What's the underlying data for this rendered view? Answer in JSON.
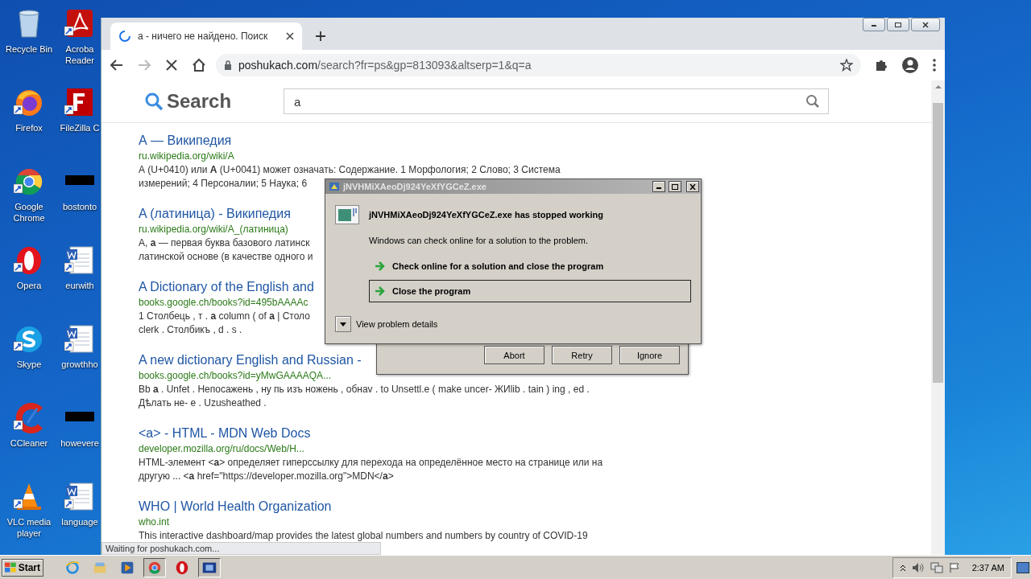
{
  "desktop_icons": [
    {
      "label": "Recycle Bin"
    },
    {
      "label": "Acroba\nReader"
    },
    {
      "label": "Firefox"
    },
    {
      "label": "FileZilla C"
    },
    {
      "label": "Google Chrome"
    },
    {
      "label": "bostonto"
    },
    {
      "label": "Opera"
    },
    {
      "label": "eurwith"
    },
    {
      "label": "Skype"
    },
    {
      "label": "growthho"
    },
    {
      "label": "CCleaner"
    },
    {
      "label": "howevere"
    },
    {
      "label": "VLC media player"
    },
    {
      "label": "language"
    }
  ],
  "browser": {
    "tab_title": "а - ничего не найдено. Поиск",
    "url_host": "poshukach.com",
    "url_path": "/search?fr=ps&gp=813093&altserp=1&q=a",
    "status_bar": "Waiting for poshukach.com..."
  },
  "page": {
    "logo": "Search",
    "query": "a",
    "results": [
      {
        "title": "А — Википедия",
        "url": "ru.wikipedia.org/wiki/A",
        "snippet": [
          "А (U+0410) или **A** (U+0041) может означать: Содержание. 1 Морфология; 2 Слово; 3 Система",
          "измерений; 4 Персоналии; 5 Наука; 6"
        ]
      },
      {
        "title": "A (латиница) - Википедия",
        "url": "ru.wikipedia.org/wiki/A_(латиница)",
        "snippet": [
          "A, **a** — первая буква базового латинск",
          "латинской основе (в качестве одного и"
        ]
      },
      {
        "title": "A Dictionary of the English and",
        "url": "books.google.ch/books?id=495bAAAAc",
        "snippet": [
          "1 Столбець , т . **а** column ( of **а** | Столо",
          "clerk . Столбикъ , d . s ."
        ]
      },
      {
        "title": "A new dictionary English and Russian -",
        "url": "books.google.ch/books?id=yMwGAAAAQA...",
        "snippet": [
          "Bb **а** . Unfet . Непосажень , ну пь изъ ножень , обнav . to Unsettl.e ( make uncer- ЖИlib . tain ) ing , ed .",
          "Дѣлать не- е . Uzusheathed ."
        ]
      },
      {
        "title": "<a> - HTML - MDN Web Docs",
        "url": "developer.mozilla.org/ru/docs/Web/H...",
        "snippet": [
          "HTML-элемент <**a**> определяет гиперссылку для перехода на определённое место на странице или на",
          "другую ... <**a** href=\"https://developer.mozilla.org\">MDN</**a**>"
        ]
      },
      {
        "title": "WHO | World Health Organization",
        "url": "who.int",
        "snippet": [
          "This interactive dashboard/map provides the latest global numbers and numbers by country of COVID-19"
        ]
      }
    ]
  },
  "retry_dialog": {
    "buttons": [
      "Abort",
      "Retry",
      "Ignore"
    ]
  },
  "crash_dialog": {
    "title": "jNVHMiXAeoDj924YeXfYGCeZ.exe",
    "heading": "jNVHMiXAeoDj924YeXfYGCeZ.exe has stopped working",
    "message": "Windows can check online for a solution to the problem.",
    "options": [
      {
        "label": "Check online for a solution and close the program",
        "selected": false
      },
      {
        "label": "Close the program",
        "selected": true
      }
    ],
    "details": "View problem details"
  },
  "taskbar": {
    "start": "Start",
    "items": [
      {
        "active": false
      },
      {
        "active": false
      },
      {
        "active": false
      },
      {
        "active": true
      },
      {
        "active": false
      },
      {
        "active": true
      }
    ],
    "clock": "2:37 AM"
  }
}
